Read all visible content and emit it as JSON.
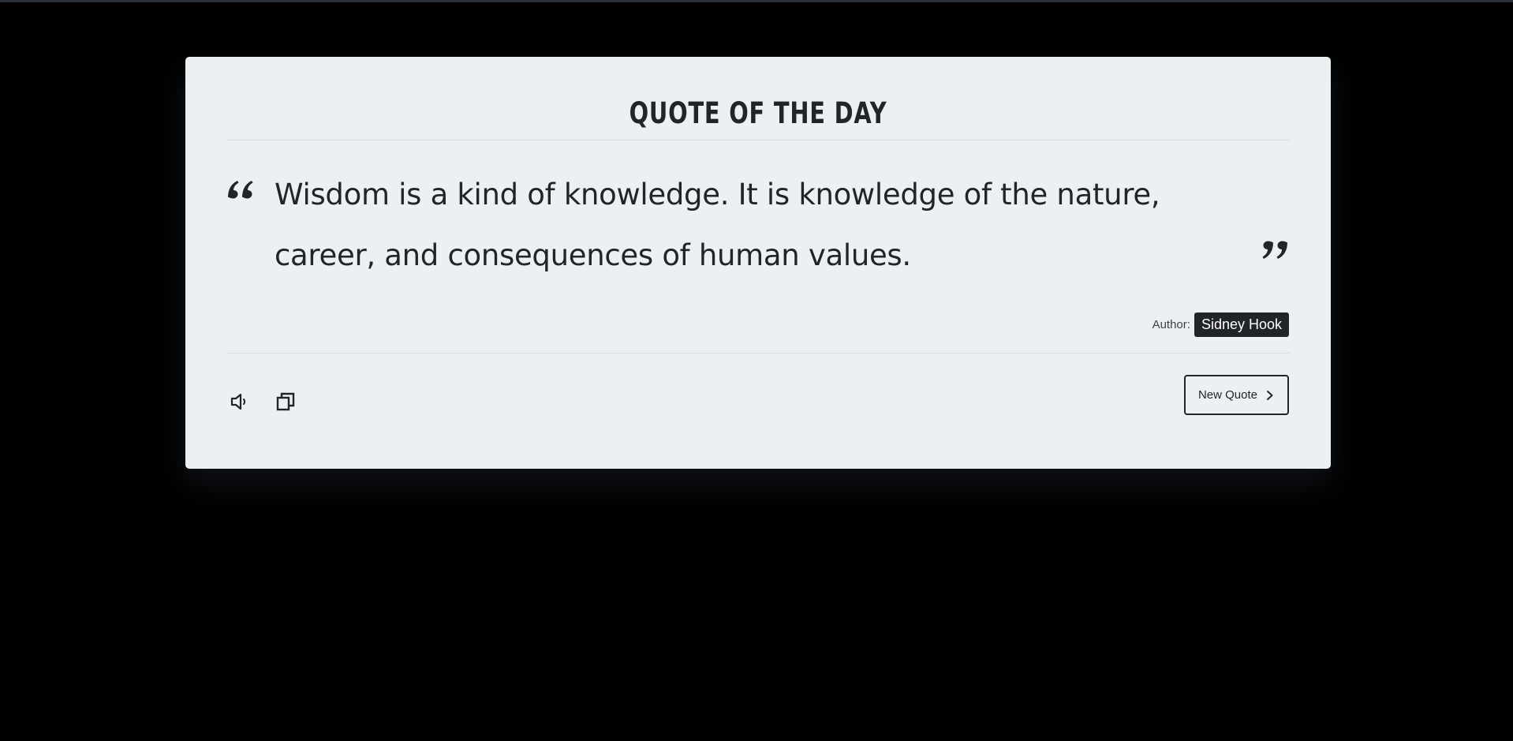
{
  "card": {
    "title": "QUOTE OF THE DAY",
    "quote": "Wisdom is a kind of knowledge. It is knowledge of the nature, career, and consequences of human values.",
    "author_label": "Author:",
    "author_name": "Sidney Hook"
  },
  "actions": {
    "speak_icon": "speaker-icon",
    "copy_icon": "copy-icon",
    "new_quote_label": "New Quote",
    "new_quote_icon": "chevron-right-icon"
  },
  "colors": {
    "page_background": "#000000",
    "card_background": "#ebf1f3",
    "text": "#212529",
    "badge_background": "#212529",
    "badge_text": "#ffffff"
  }
}
